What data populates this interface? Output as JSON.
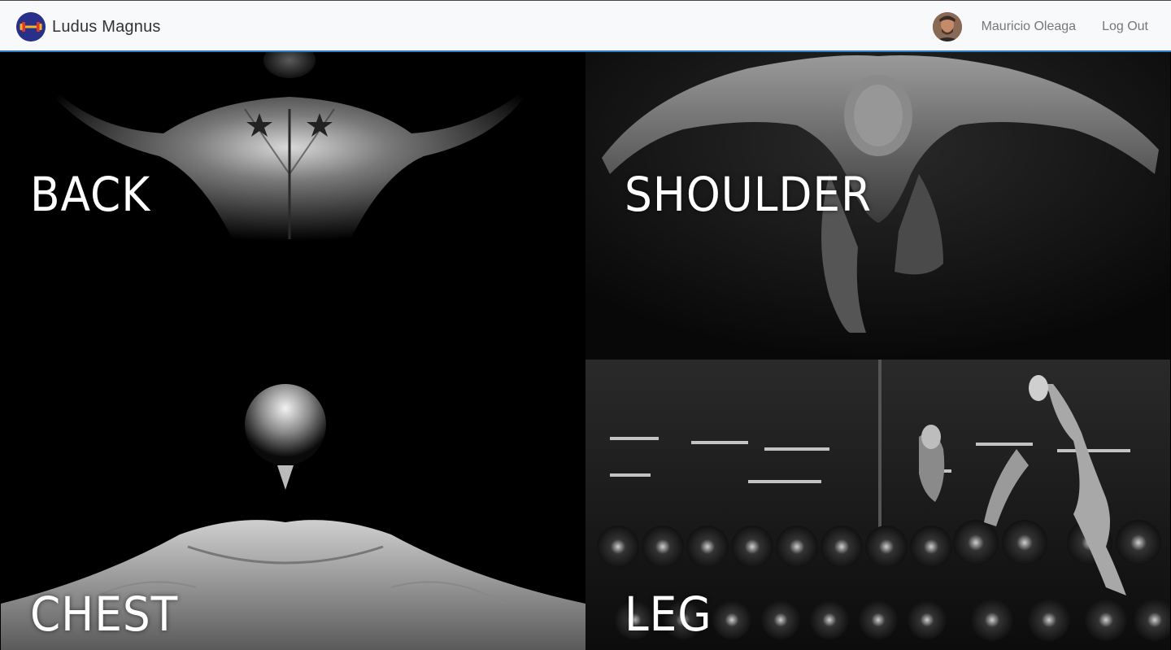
{
  "navbar": {
    "brand": {
      "name": "Ludus Magnus",
      "logo_icon": "dumbbell-icon"
    },
    "user": {
      "name": "Mauricio Oleaga",
      "avatar_icon": "user-avatar"
    },
    "logout_label": "Log Out",
    "accent_color": "#2f7fc1"
  },
  "categories": [
    {
      "label": "BACK"
    },
    {
      "label": "SHOULDER"
    },
    {
      "label": "CHEST"
    },
    {
      "label": "LEG"
    }
  ]
}
